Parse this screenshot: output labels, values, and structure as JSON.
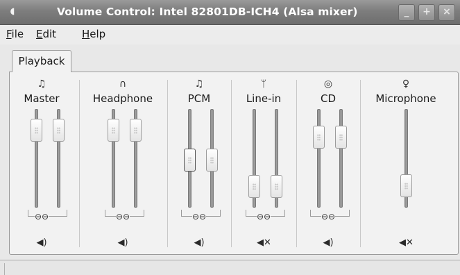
{
  "window": {
    "title": "Volume Control: Intel 82801DB-ICH4 (Alsa mixer)",
    "buttons": {
      "minimize": "_",
      "maximize": "+",
      "close": "×"
    },
    "app_icon": "speaker-icon"
  },
  "menu": [
    {
      "label": "File",
      "mnemonic": "F",
      "rest": "ile"
    },
    {
      "label": "Edit",
      "mnemonic": "E",
      "rest": "dit"
    },
    {
      "label": "Help",
      "mnemonic": "H",
      "rest": "elp"
    }
  ],
  "tabs": [
    {
      "label": "Playback",
      "active": true
    }
  ],
  "channels": [
    {
      "name": "Master",
      "icon": "music-note-icon",
      "glyph": "♫",
      "stereo": true,
      "level": 0.87,
      "linked": true,
      "muted": false
    },
    {
      "name": "Headphone",
      "icon": "headphones-icon",
      "glyph": "∩",
      "stereo": true,
      "level": 0.87,
      "linked": true,
      "muted": false
    },
    {
      "name": "PCM",
      "icon": "music-note-icon",
      "glyph": "♫",
      "stereo": true,
      "level": 0.48,
      "linked": true,
      "muted": false
    },
    {
      "name": "Line-in",
      "icon": "line-in-plug-icon",
      "glyph": "ᛘ",
      "stereo": true,
      "level": 0.13,
      "linked": true,
      "muted": true
    },
    {
      "name": "CD",
      "icon": "cd-icon",
      "glyph": "◎",
      "stereo": true,
      "level": 0.78,
      "linked": true,
      "muted": false
    },
    {
      "name": "Microphone",
      "icon": "microphone-icon",
      "glyph": "♀",
      "stereo": false,
      "level": 0.14,
      "linked": false,
      "muted": true
    }
  ],
  "icons": {
    "chain": "⊖⊖",
    "speaker_on": "◀)",
    "speaker_muted": "◀✕"
  }
}
